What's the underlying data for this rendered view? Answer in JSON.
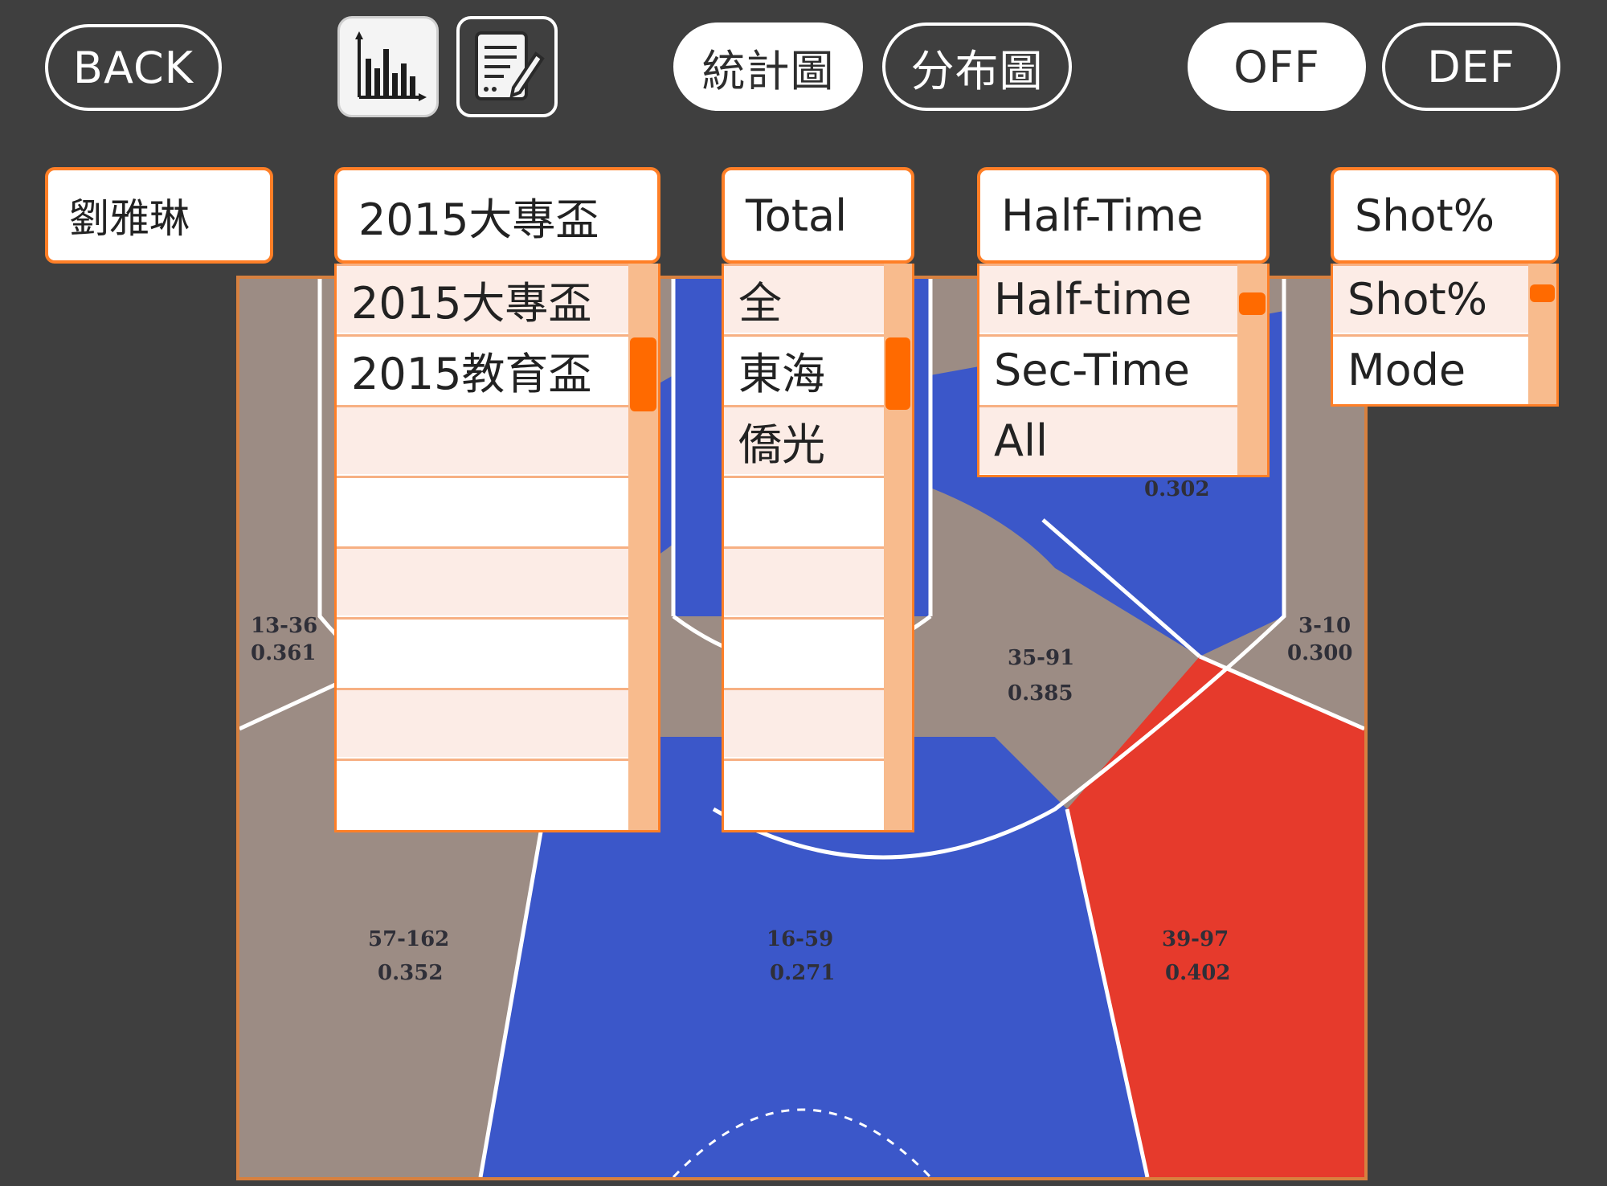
{
  "toolbar": {
    "back_label": "BACK",
    "chart_icon": "bar-chart-icon",
    "notes_icon": "edit-notes-icon",
    "view_tabs": [
      {
        "label": "統計圖",
        "active": true
      },
      {
        "label": "分布圖",
        "active": false
      }
    ],
    "side_tabs": [
      {
        "label": "OFF",
        "active": true
      },
      {
        "label": "DEF",
        "active": false
      }
    ]
  },
  "filters": {
    "player": {
      "value": "劉雅琳"
    },
    "tournament": {
      "value": "2015大專盃",
      "options": [
        "2015大專盃",
        "2015教育盃",
        "",
        "",
        "",
        "",
        "",
        ""
      ]
    },
    "opponent": {
      "value": "Total",
      "options": [
        "全",
        "東海",
        "僑光",
        "",
        "",
        "",
        "",
        ""
      ]
    },
    "period": {
      "value": "Half-Time",
      "options": [
        "Half-time",
        "Sec-Time",
        "All"
      ]
    },
    "metric": {
      "value": "Shot%",
      "options": [
        "Shot%",
        "Mode"
      ]
    }
  },
  "court": {
    "colors": {
      "hot": "#e63a2c",
      "cold": "#3b57c9",
      "neutral": "#9c8c84",
      "line": "#ffffff"
    },
    "zones": [
      {
        "id": "left-corner-three",
        "made_attempts": "13-36",
        "pct": "0.361",
        "tone": "neutral"
      },
      {
        "id": "right-corner-three",
        "made_attempts": "3-10",
        "pct": "0.300",
        "tone": "neutral"
      },
      {
        "id": "right-elbow-mid",
        "made_attempts": "35-91",
        "pct": "0.385",
        "tone": "neutral"
      },
      {
        "id": "right-wing-mid",
        "made_attempts": "",
        "pct": "0.302",
        "tone": "cold"
      },
      {
        "id": "left-wing-three",
        "made_attempts": "57-162",
        "pct": "0.352",
        "tone": "neutral"
      },
      {
        "id": "top-of-key-three",
        "made_attempts": "16-59",
        "pct": "0.271",
        "tone": "cold"
      },
      {
        "id": "right-wing-three",
        "made_attempts": "39-97",
        "pct": "0.402",
        "tone": "hot"
      }
    ]
  }
}
